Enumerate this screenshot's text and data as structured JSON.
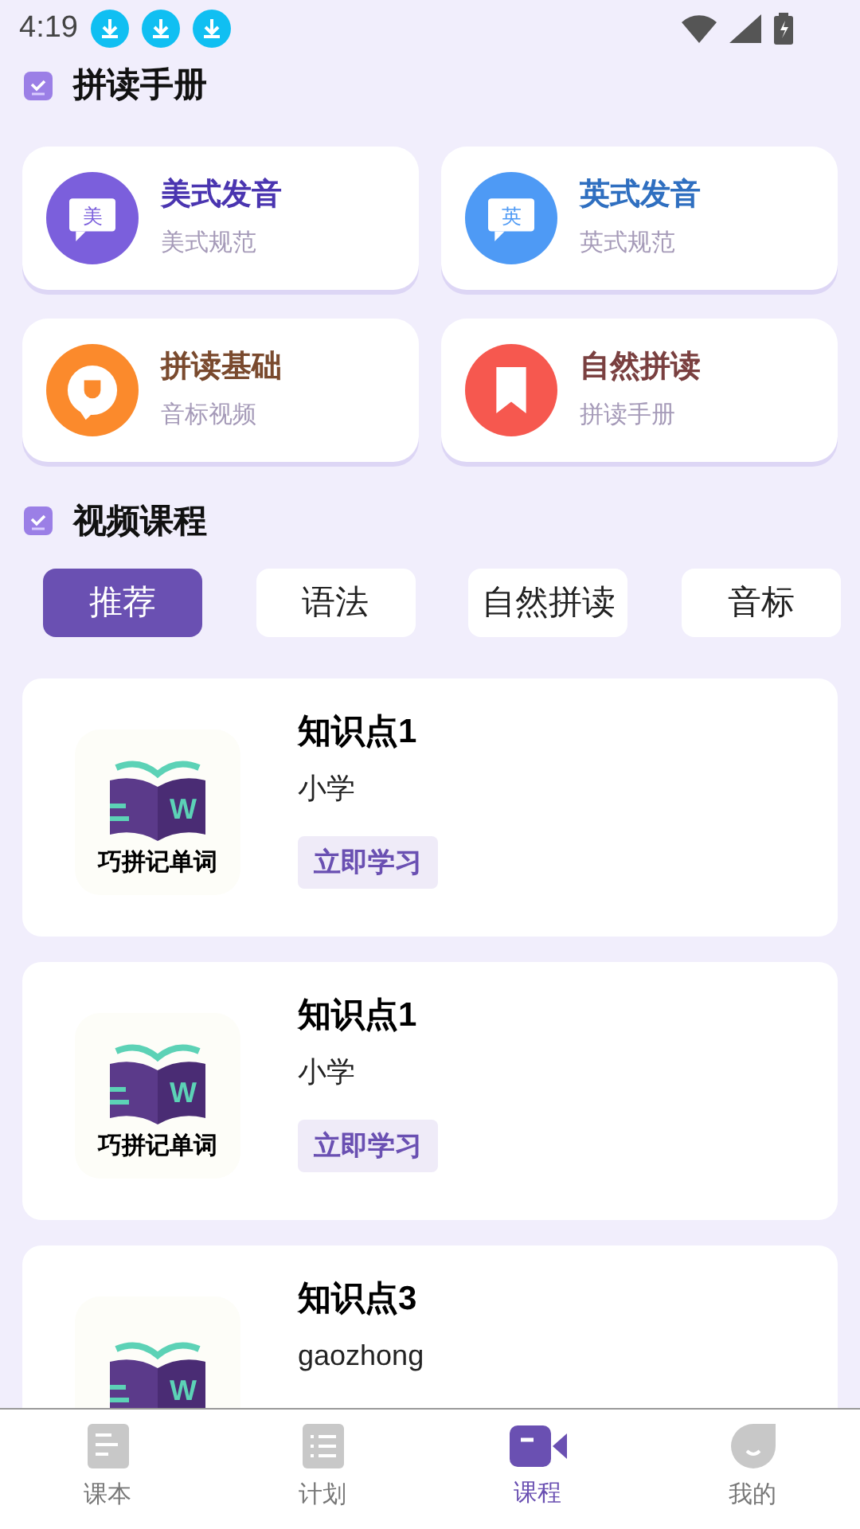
{
  "status_bar": {
    "time": "4:19",
    "notifications": [
      {
        "kind": "download"
      },
      {
        "kind": "download"
      },
      {
        "kind": "download"
      }
    ]
  },
  "section_1": {
    "title": "拼读手册"
  },
  "quick_cards": [
    {
      "kind": "speech",
      "badge": "美",
      "title": "美式发音",
      "subtitle": "美式规范",
      "color": "#7b5fdc"
    },
    {
      "kind": "speech",
      "badge": "英",
      "title": "英式发音",
      "subtitle": "英式规范",
      "color": "#4e9af5"
    },
    {
      "kind": "chat",
      "title": "拼读基础",
      "subtitle": "音标视频",
      "color": "#fb8a2c"
    },
    {
      "kind": "bookmark",
      "title": "自然拼读",
      "subtitle": "拼读手册",
      "color": "#f6584f"
    }
  ],
  "section_2": {
    "title": "视频课程"
  },
  "tabs": [
    {
      "label": "推荐",
      "selected": true
    },
    {
      "label": "语法",
      "selected": false
    },
    {
      "label": "自然拼读",
      "selected": false
    },
    {
      "label": "音标",
      "selected": false
    }
  ],
  "courses": [
    {
      "logo_letter": "W",
      "logo_caption": "巧拼记单词",
      "title": "知识点1",
      "level": "小学",
      "action": "立即学习"
    },
    {
      "logo_letter": "W",
      "logo_caption": "巧拼记单词",
      "title": "知识点1",
      "level": "小学",
      "action": "立即学习"
    },
    {
      "logo_letter": "W",
      "title": "知识点3",
      "level": "gaozhong"
    }
  ],
  "bottom_nav": [
    {
      "kind": "book",
      "label": "课本",
      "selected": false
    },
    {
      "kind": "list",
      "label": "计划",
      "selected": false
    },
    {
      "kind": "video",
      "label": "课程",
      "selected": true
    },
    {
      "kind": "face",
      "label": "我的",
      "selected": false
    }
  ]
}
